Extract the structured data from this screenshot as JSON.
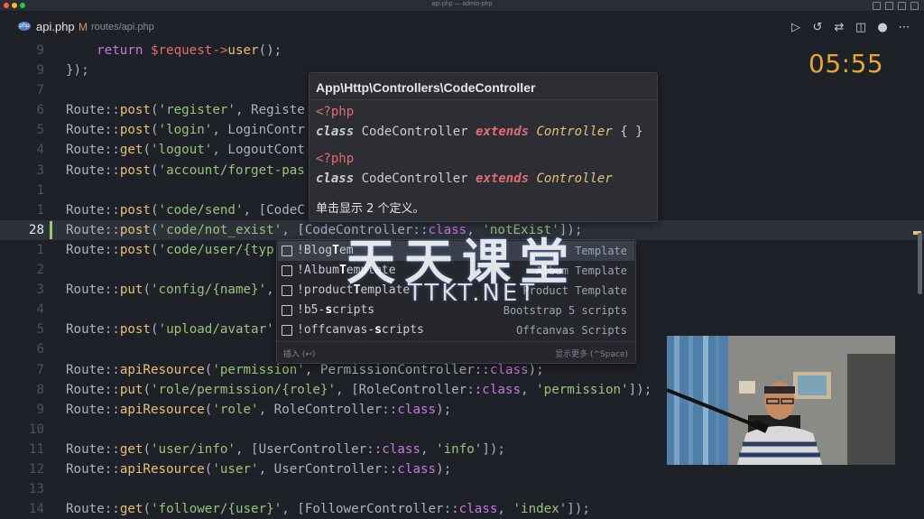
{
  "window": {
    "title": "api.php — admin-php",
    "traffic_colors": [
      "#ff5f57",
      "#febc2e",
      "#28c840"
    ]
  },
  "tab": {
    "icon": "php-icon",
    "icon_text": "php",
    "filename": "api.php",
    "modified": "M",
    "path": "routes/api.php"
  },
  "toolbar": {
    "run": "▷",
    "history": "↺",
    "compare": "⇄",
    "split": "◫",
    "dot": "●",
    "more": "⋯"
  },
  "timer": "05:55",
  "editor": {
    "lines": [
      {
        "num": "9",
        "tokens": [
          [
            "t-default",
            "    "
          ],
          [
            "t-keyword",
            "return"
          ],
          [
            "t-default",
            " "
          ],
          [
            "t-var",
            "$request"
          ],
          [
            "t-op",
            "->"
          ],
          [
            "t-method",
            "user"
          ],
          [
            "t-punc",
            "();"
          ]
        ]
      },
      {
        "num": "9",
        "tokens": [
          [
            "t-punc",
            "});"
          ]
        ]
      },
      {
        "num": "7",
        "tokens": []
      },
      {
        "num": "6",
        "tokens": [
          [
            "t-class",
            "Route"
          ],
          [
            "t-punc",
            "::"
          ],
          [
            "t-method",
            "post"
          ],
          [
            "t-punc",
            "("
          ],
          [
            "t-string",
            "'register'"
          ],
          [
            "t-punc",
            ", "
          ],
          [
            "t-class",
            "Registe"
          ]
        ]
      },
      {
        "num": "5",
        "tokens": [
          [
            "t-class",
            "Route"
          ],
          [
            "t-punc",
            "::"
          ],
          [
            "t-method",
            "post"
          ],
          [
            "t-punc",
            "("
          ],
          [
            "t-string",
            "'login'"
          ],
          [
            "t-punc",
            ", "
          ],
          [
            "t-class",
            "LoginContr"
          ]
        ]
      },
      {
        "num": "4",
        "tokens": [
          [
            "t-class",
            "Route"
          ],
          [
            "t-punc",
            "::"
          ],
          [
            "t-method",
            "get"
          ],
          [
            "t-punc",
            "("
          ],
          [
            "t-string",
            "'logout'"
          ],
          [
            "t-punc",
            ", "
          ],
          [
            "t-class",
            "LogoutCont"
          ]
        ]
      },
      {
        "num": "3",
        "tokens": [
          [
            "t-class",
            "Route"
          ],
          [
            "t-punc",
            "::"
          ],
          [
            "t-method",
            "post"
          ],
          [
            "t-punc",
            "("
          ],
          [
            "t-string",
            "'account/forget-pas"
          ]
        ]
      },
      {
        "num": "1",
        "tokens": []
      },
      {
        "num": "1",
        "tokens": [
          [
            "t-class",
            "Route"
          ],
          [
            "t-punc",
            "::"
          ],
          [
            "t-method",
            "post"
          ],
          [
            "t-punc",
            "("
          ],
          [
            "t-string",
            "'code/send'"
          ],
          [
            "t-punc",
            ", ["
          ],
          [
            "t-class",
            "CodeC"
          ]
        ]
      },
      {
        "num": "28",
        "current": true,
        "tokens": [
          [
            "t-class",
            "Route"
          ],
          [
            "t-punc",
            "::"
          ],
          [
            "t-method",
            "post"
          ],
          [
            "t-punc",
            "("
          ],
          [
            "t-string",
            "'code/not_exist'"
          ],
          [
            "t-punc",
            ", ["
          ],
          [
            "t-class",
            "CodeController"
          ],
          [
            "t-punc",
            "::"
          ],
          [
            "t-keyword",
            "class"
          ],
          [
            "t-punc",
            ", "
          ],
          [
            "t-string",
            "'notExist'"
          ],
          [
            "t-punc",
            "]);"
          ]
        ]
      },
      {
        "num": "1",
        "tokens": [
          [
            "t-class",
            "Route"
          ],
          [
            "t-punc",
            "::"
          ],
          [
            "t-method",
            "post"
          ],
          [
            "t-punc",
            "("
          ],
          [
            "t-string",
            "'code/user/{typ"
          ]
        ]
      },
      {
        "num": "2",
        "tokens": []
      },
      {
        "num": "3",
        "tokens": [
          [
            "t-class",
            "Route"
          ],
          [
            "t-punc",
            "::"
          ],
          [
            "t-method",
            "put"
          ],
          [
            "t-punc",
            "("
          ],
          [
            "t-string",
            "'config/{name}'"
          ],
          [
            "t-punc",
            ","
          ]
        ]
      },
      {
        "num": "4",
        "tokens": []
      },
      {
        "num": "5",
        "tokens": [
          [
            "t-class",
            "Route"
          ],
          [
            "t-punc",
            "::"
          ],
          [
            "t-method",
            "post"
          ],
          [
            "t-punc",
            "("
          ],
          [
            "t-string",
            "'upload/avatar'"
          ]
        ]
      },
      {
        "num": "6",
        "tokens": []
      },
      {
        "num": "7",
        "tokens": [
          [
            "t-class",
            "Route"
          ],
          [
            "t-punc",
            "::"
          ],
          [
            "t-method",
            "apiResource"
          ],
          [
            "t-punc",
            "("
          ],
          [
            "t-string",
            "'permission'"
          ],
          [
            "t-punc",
            ", "
          ],
          [
            "t-class",
            "PermissionController"
          ],
          [
            "t-punc",
            "::"
          ],
          [
            "t-keyword",
            "class"
          ],
          [
            "t-punc",
            ");"
          ]
        ]
      },
      {
        "num": "8",
        "tokens": [
          [
            "t-class",
            "Route"
          ],
          [
            "t-punc",
            "::"
          ],
          [
            "t-method",
            "put"
          ],
          [
            "t-punc",
            "("
          ],
          [
            "t-string",
            "'role/permission/{role}'"
          ],
          [
            "t-punc",
            ", ["
          ],
          [
            "t-class",
            "RoleController"
          ],
          [
            "t-punc",
            "::"
          ],
          [
            "t-keyword",
            "class"
          ],
          [
            "t-punc",
            ", "
          ],
          [
            "t-string",
            "'permission'"
          ],
          [
            "t-punc",
            "]);"
          ]
        ]
      },
      {
        "num": "9",
        "tokens": [
          [
            "t-class",
            "Route"
          ],
          [
            "t-punc",
            "::"
          ],
          [
            "t-method",
            "apiResource"
          ],
          [
            "t-punc",
            "("
          ],
          [
            "t-string",
            "'role'"
          ],
          [
            "t-punc",
            ", "
          ],
          [
            "t-class",
            "RoleController"
          ],
          [
            "t-punc",
            "::"
          ],
          [
            "t-keyword",
            "class"
          ],
          [
            "t-punc",
            ");"
          ]
        ]
      },
      {
        "num": "10",
        "tokens": []
      },
      {
        "num": "11",
        "tokens": [
          [
            "t-class",
            "Route"
          ],
          [
            "t-punc",
            "::"
          ],
          [
            "t-method",
            "get"
          ],
          [
            "t-punc",
            "("
          ],
          [
            "t-string",
            "'user/info'"
          ],
          [
            "t-punc",
            ", ["
          ],
          [
            "t-class",
            "UserController"
          ],
          [
            "t-punc",
            "::"
          ],
          [
            "t-keyword",
            "class"
          ],
          [
            "t-punc",
            ", "
          ],
          [
            "t-string",
            "'info'"
          ],
          [
            "t-punc",
            "]);"
          ]
        ]
      },
      {
        "num": "12",
        "tokens": [
          [
            "t-class",
            "Route"
          ],
          [
            "t-punc",
            "::"
          ],
          [
            "t-method",
            "apiResource"
          ],
          [
            "t-punc",
            "("
          ],
          [
            "t-string",
            "'user'"
          ],
          [
            "t-punc",
            ", "
          ],
          [
            "t-class",
            "UserController"
          ],
          [
            "t-punc",
            "::"
          ],
          [
            "t-keyword",
            "class"
          ],
          [
            "t-punc",
            ");"
          ]
        ]
      },
      {
        "num": "13",
        "tokens": []
      },
      {
        "num": "14",
        "tokens": [
          [
            "t-class",
            "Route"
          ],
          [
            "t-punc",
            "::"
          ],
          [
            "t-method",
            "get"
          ],
          [
            "t-punc",
            "("
          ],
          [
            "t-string",
            "'follower/{user}'"
          ],
          [
            "t-punc",
            ", ["
          ],
          [
            "t-class",
            "FollowerController"
          ],
          [
            "t-punc",
            "::"
          ],
          [
            "t-keyword",
            "class"
          ],
          [
            "t-punc",
            ", "
          ],
          [
            "t-string",
            "'index'"
          ],
          [
            "t-punc",
            "]);"
          ]
        ]
      }
    ]
  },
  "hover": {
    "title": "App\\Http\\Controllers\\CodeController",
    "definitions": [
      {
        "open_tag": "<?php",
        "keyword": "class",
        "name": "CodeController",
        "extends": "extends",
        "parent": "Controller",
        "suffix": " { }"
      },
      {
        "open_tag": "<?php",
        "keyword": "class",
        "name": "CodeController",
        "extends": "extends",
        "parent": "Controller",
        "suffix": ""
      }
    ],
    "note": "单击显示 2 个定义。"
  },
  "suggest": {
    "items": [
      {
        "pre": "!Blog",
        "match": "T",
        "post": "em",
        "detail": "Template",
        "selected": true
      },
      {
        "pre": "!Album",
        "match": "T",
        "post": "emplate",
        "detail": "Album Template"
      },
      {
        "pre": "!product",
        "match": "T",
        "post": "emplate",
        "detail": "Product Template"
      },
      {
        "pre": "!b5-",
        "match": "s",
        "post": "cripts",
        "detail": "Bootstrap 5 scripts"
      },
      {
        "pre": "!offcanvas-",
        "match": "s",
        "post": "cripts",
        "detail": "Offcanvas Scripts"
      }
    ],
    "footer_left": "插入 (↩)",
    "footer_right": "显示更多 (^Space)"
  },
  "watermark": {
    "cn": "天天课堂",
    "en": "TTKT.NET"
  }
}
